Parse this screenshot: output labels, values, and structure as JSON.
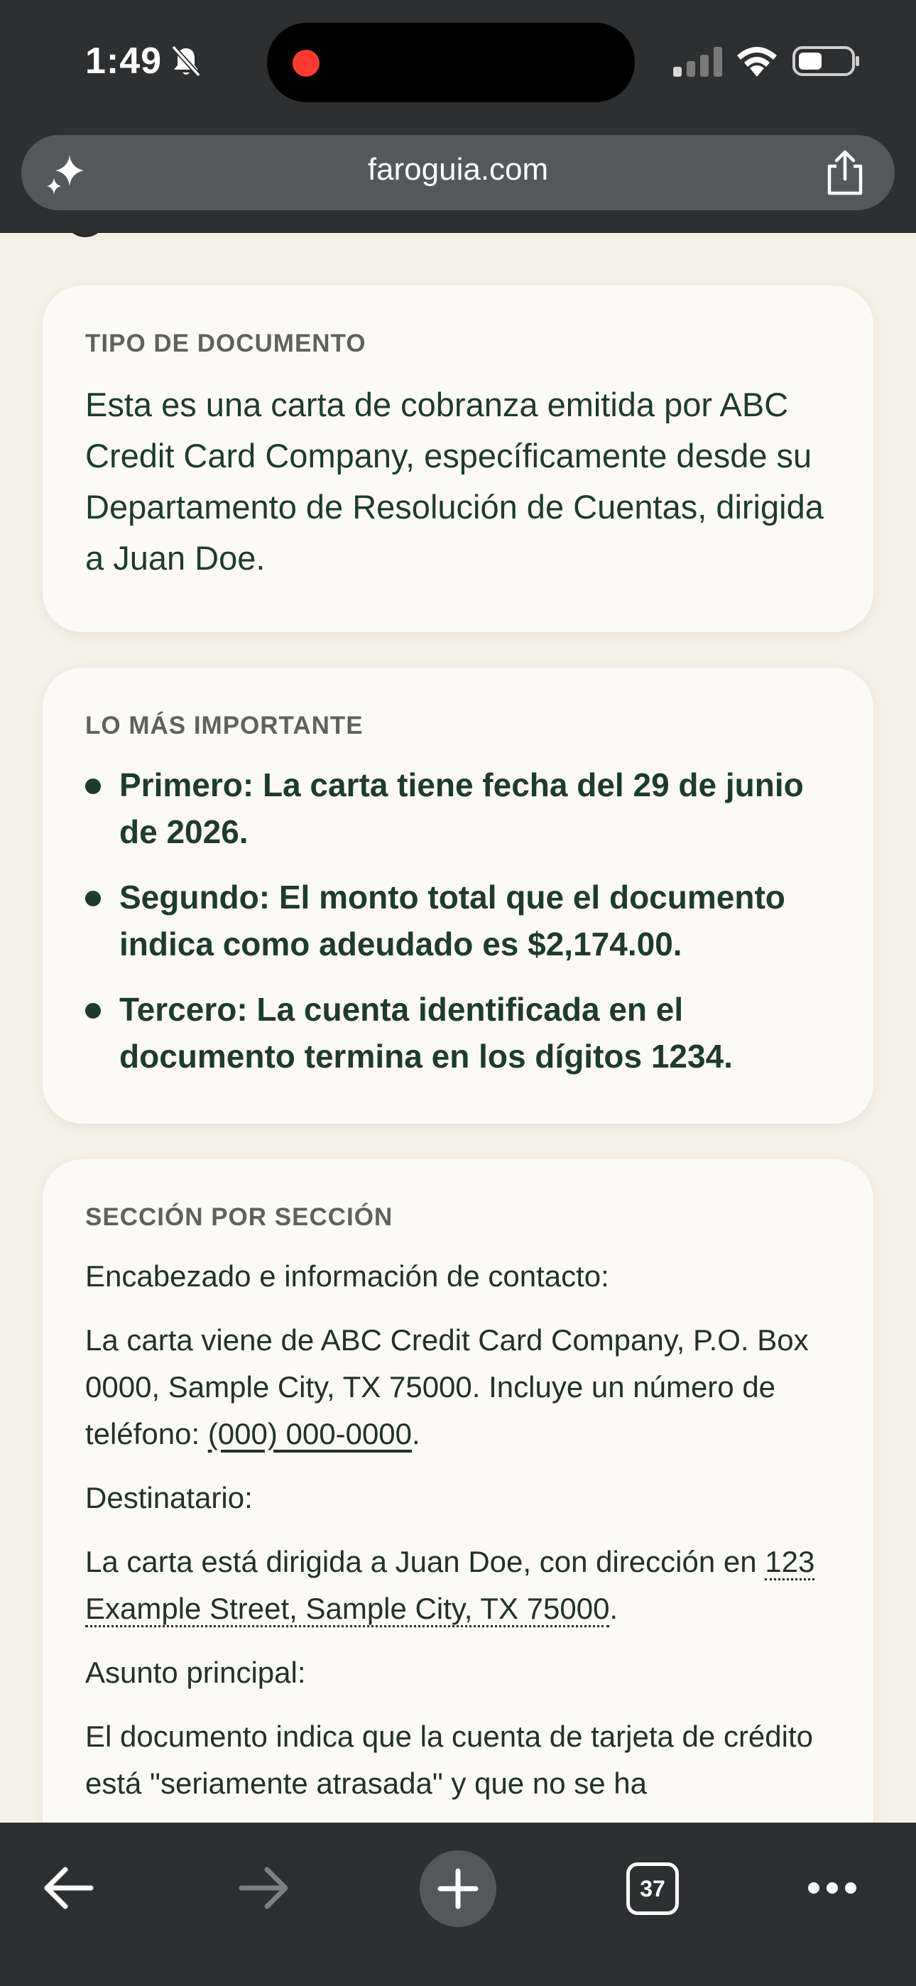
{
  "status_bar": {
    "time": "1:49",
    "icons": [
      "bell-slash-icon",
      "cellular-signal-icon",
      "wifi-icon",
      "battery-icon"
    ]
  },
  "browser": {
    "url": "faroguia.com",
    "icons": [
      "sparkle-icon",
      "share-icon"
    ]
  },
  "cards": {
    "document_type": {
      "label": "TIPO DE DOCUMENTO",
      "text": "Esta es una carta de cobranza emitida por ABC Credit Card Company, específicamente desde su Departamento de Resolución de Cuentas, dirigida a Juan Doe."
    },
    "key_points": {
      "label": "LO MÁS IMPORTANTE",
      "items": [
        "Primero: La carta tiene fecha del 29 de junio de 2026.",
        "Segundo: El monto total que el documento indica como adeudado es $2,174.00.",
        "Tercero: La cuenta identificada en el documento termina en los dígitos 1234."
      ]
    },
    "sections": {
      "label": "SECCIÓN POR SECCIÓN",
      "header_title": "Encabezado e información de contacto:",
      "header_text": "La carta viene de ABC Credit Card Company, P.O. Box 0000, Sample City, TX 75000. Incluye un número de teléfono: ",
      "phone": "(000) 000-0000",
      "recipient_title": "Destinatario:",
      "recipient_text": "La carta está dirigida a Juan Doe, con dirección en ",
      "address": "123 Example Street, Sample City, TX 75000",
      "subject_title": "Asunto principal:",
      "subject_text": "El documento indica que la cuenta de tarjeta de crédito está \"seriamente atrasada\" y que no se ha"
    }
  },
  "toolbar": {
    "tab_count": "37",
    "icons": [
      "back-arrow-icon",
      "forward-arrow-icon",
      "new-tab-plus-icon",
      "tabs-icon",
      "more-icon"
    ]
  },
  "colors": {
    "chrome": "#2d2f31",
    "page_bg": "#f5f0e7",
    "card_bg": "#fbfaf6",
    "text": "#1f3a2e",
    "recording": "#ff3b30"
  }
}
